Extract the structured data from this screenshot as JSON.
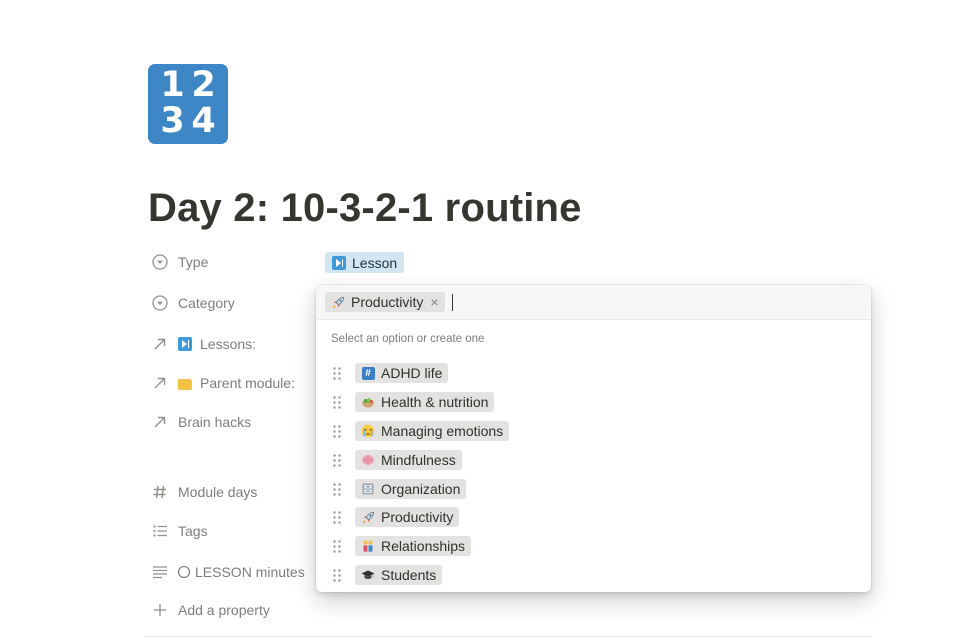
{
  "page": {
    "icon_digits": [
      "1",
      "2",
      "3",
      "4"
    ],
    "title": "Day 2: 10-3-2-1 routine"
  },
  "properties": {
    "type_label": "Type",
    "type_value": "Lesson",
    "category_label": "Category",
    "lessons_label": "Lessons:",
    "parent_module_label": "Parent module:",
    "brain_hacks_label": "Brain hacks",
    "module_days_label": "Module days",
    "tags_label": "Tags",
    "lesson_minutes_label": "LESSON minutes",
    "add_property_label": "Add a property"
  },
  "dropdown": {
    "selected_chip": "Productivity",
    "remove_glyph": "×",
    "hint": "Select an option or create one",
    "options": [
      {
        "label": "ADHD life",
        "icon": "hash-icon"
      },
      {
        "label": "Health & nutrition",
        "icon": "salad-icon"
      },
      {
        "label": "Managing emotions",
        "icon": "crying-face-icon"
      },
      {
        "label": "Mindfulness",
        "icon": "brain-icon"
      },
      {
        "label": "Organization",
        "icon": "file-cabinet-icon"
      },
      {
        "label": "Productivity",
        "icon": "rocket-icon"
      },
      {
        "label": "Relationships",
        "icon": "couple-icon"
      },
      {
        "label": "Students",
        "icon": "graduation-cap-icon"
      }
    ]
  },
  "colors": {
    "page_icon_bg": "#3d87c7",
    "type_pill_bg": "#d3e5ef",
    "chip_bg": "#e3e2e0",
    "text": "#37352f"
  }
}
